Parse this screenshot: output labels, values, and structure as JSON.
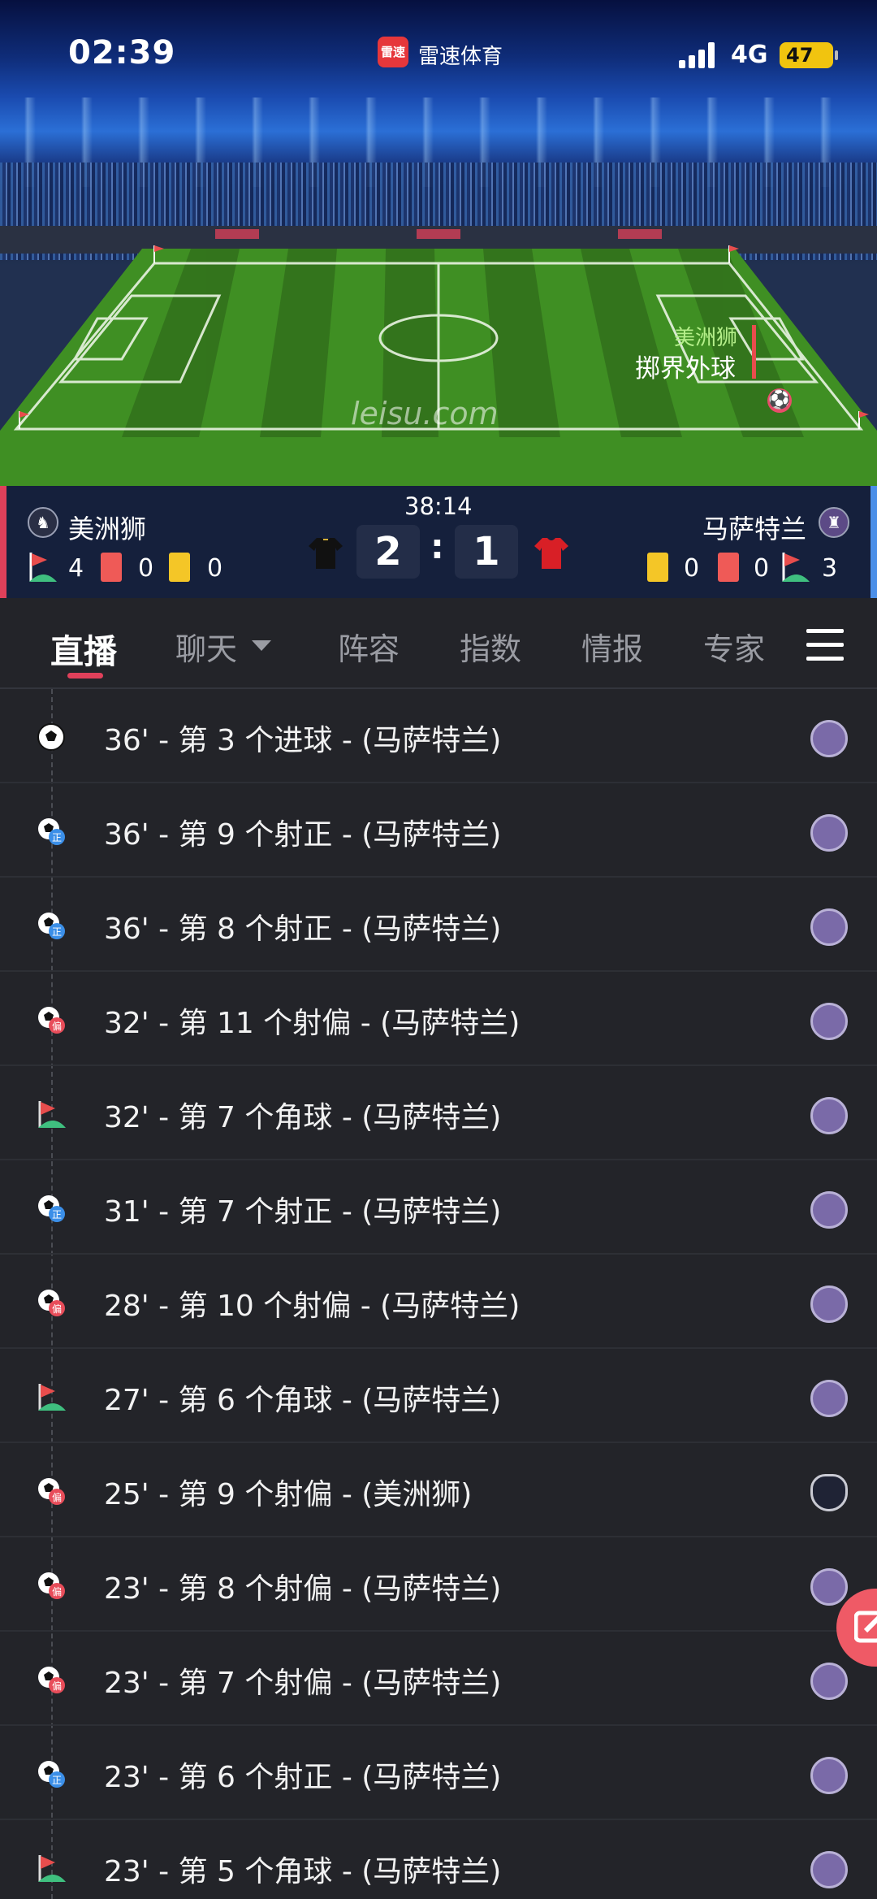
{
  "status": {
    "time": "02:39",
    "app_badge": "雷速",
    "app_name": "雷速体育",
    "network": "4G",
    "battery": "47"
  },
  "pitch": {
    "event_team": "美洲狮",
    "event_text": "掷界外球",
    "watermark": "leisu.com",
    "ball_icon": "soccer-ball-icon"
  },
  "match": {
    "clock": "38:14",
    "home": {
      "name": "美洲狮",
      "corners": "4",
      "red": "0",
      "yellow": "0",
      "score": "2",
      "jersey_color": "#111111"
    },
    "away": {
      "name": "马萨特兰",
      "corners": "3",
      "red": "0",
      "yellow": "0",
      "score": "1",
      "jersey_color": "#d81f26"
    },
    "separator": ":"
  },
  "tabs": [
    {
      "label": "直播",
      "active": true
    },
    {
      "label": "聊天"
    },
    {
      "label": "阵容"
    },
    {
      "label": "指数"
    },
    {
      "label": "情报"
    },
    {
      "label": "专家"
    }
  ],
  "events": [
    {
      "text": "36' - 第 3 个进球 - (马萨特兰)",
      "icon": "goal-icon",
      "team": "away"
    },
    {
      "text": "36' - 第 9 个射正 - (马萨特兰)",
      "icon": "shot-on-target-icon",
      "team": "away"
    },
    {
      "text": "36' - 第 8 个射正 - (马萨特兰)",
      "icon": "shot-on-target-icon",
      "team": "away"
    },
    {
      "text": "32' - 第 11 个射偏 - (马萨特兰)",
      "icon": "shot-off-target-icon",
      "team": "away"
    },
    {
      "text": "32' - 第 7 个角球 - (马萨特兰)",
      "icon": "corner-flag-icon",
      "team": "away"
    },
    {
      "text": "31' - 第 7 个射正 - (马萨特兰)",
      "icon": "shot-on-target-icon",
      "team": "away"
    },
    {
      "text": "28' - 第 10 个射偏 - (马萨特兰)",
      "icon": "shot-off-target-icon",
      "team": "away"
    },
    {
      "text": "27' - 第 6 个角球 - (马萨特兰)",
      "icon": "corner-flag-icon",
      "team": "away"
    },
    {
      "text": "25' - 第 9 个射偏 - (美洲狮)",
      "icon": "shot-off-target-icon",
      "team": "home"
    },
    {
      "text": "23' - 第 8 个射偏 - (马萨特兰)",
      "icon": "shot-off-target-icon",
      "team": "away"
    },
    {
      "text": "23' - 第 7 个射偏 - (马萨特兰)",
      "icon": "shot-off-target-icon",
      "team": "away"
    },
    {
      "text": "23' - 第 6 个射正 - (马萨特兰)",
      "icon": "shot-on-target-icon",
      "team": "away"
    },
    {
      "text": "23' - 第 5 个角球 - (马萨特兰)",
      "icon": "corner-flag-icon",
      "team": "away"
    }
  ],
  "icon_labels": {
    "on_target": "正",
    "off_target": "偏"
  },
  "fab_icon": "edit-icon"
}
